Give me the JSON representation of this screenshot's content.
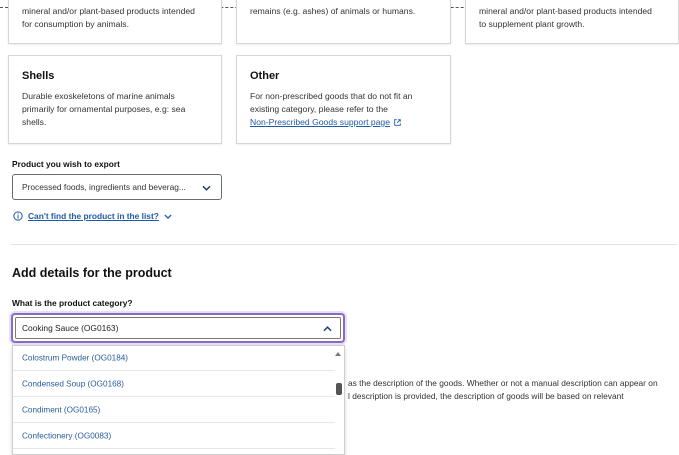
{
  "top_cards": [
    {
      "desc_line2": "for consumption by animals.",
      "desc_line1": "mineral and/or plant-based products intended"
    },
    {
      "desc_line1": "remains (e.g. ashes) of animals or humans."
    },
    {
      "desc_line1": "mineral and/or plant-based products intended",
      "desc_line2": "to supplement plant growth."
    }
  ],
  "shells_card": {
    "title": "Shells",
    "desc_line1": "Durable exoskeletons of marine animals",
    "desc_line2": "primarily for ornamental purposes, e.g: sea",
    "desc_line3": "shells."
  },
  "other_card": {
    "title": "Other",
    "desc_line1": "For non-prescribed goods that do not fit an",
    "desc_line2": "existing category, please refer to the",
    "link": "Non-Prescribed Goods support page"
  },
  "export_product": {
    "label": "Product you wish to export",
    "selected": "Processed foods, ingredients and beverag..."
  },
  "help": {
    "link": "Can't find the product in the list?"
  },
  "section": {
    "heading": "Add details for the product"
  },
  "category": {
    "label": "What is the product category?",
    "selected": "Cooking Sauce (OG0163)",
    "options": [
      "Colostrum Powder (OG0184)",
      "Condensed Soup (OG0168)",
      "Condiment (OG0165)",
      "Confectionery (OG0083)"
    ]
  },
  "background_text": {
    "line1": "as the description of the goods. Whether or not a manual description can appear on",
    "line2": "l description is provided, the description of goods will be based on relevant"
  },
  "colors": {
    "link": "#1f5aa8",
    "focus": "#8a6ac7"
  }
}
